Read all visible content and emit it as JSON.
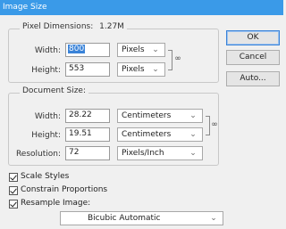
{
  "window": {
    "title": "Image Size"
  },
  "pixel_dimensions": {
    "legend": "Pixel Dimensions:",
    "size": "1.27M",
    "width_label": "Width:",
    "width_value": "800",
    "width_unit": "Pixels",
    "height_label": "Height:",
    "height_value": "553",
    "height_unit": "Pixels"
  },
  "document_size": {
    "legend": "Document Size:",
    "width_label": "Width:",
    "width_value": "28.22",
    "width_unit": "Centimeters",
    "height_label": "Height:",
    "height_value": "19.51",
    "height_unit": "Centimeters",
    "resolution_label": "Resolution:",
    "resolution_value": "72",
    "resolution_unit": "Pixels/Inch"
  },
  "options": {
    "scale_styles": {
      "label": "Scale Styles",
      "checked": true
    },
    "constrain_proportions": {
      "label": "Constrain Proportions",
      "checked": true
    },
    "resample_image": {
      "label": "Resample Image:",
      "checked": true
    },
    "resample_method": "Bicubic Automatic"
  },
  "buttons": {
    "ok": "OK",
    "cancel": "Cancel",
    "auto": "Auto..."
  },
  "icons": {
    "chain": "link-chain-icon",
    "dropdown": "chevron-down-icon",
    "check": "checkmark-icon"
  }
}
